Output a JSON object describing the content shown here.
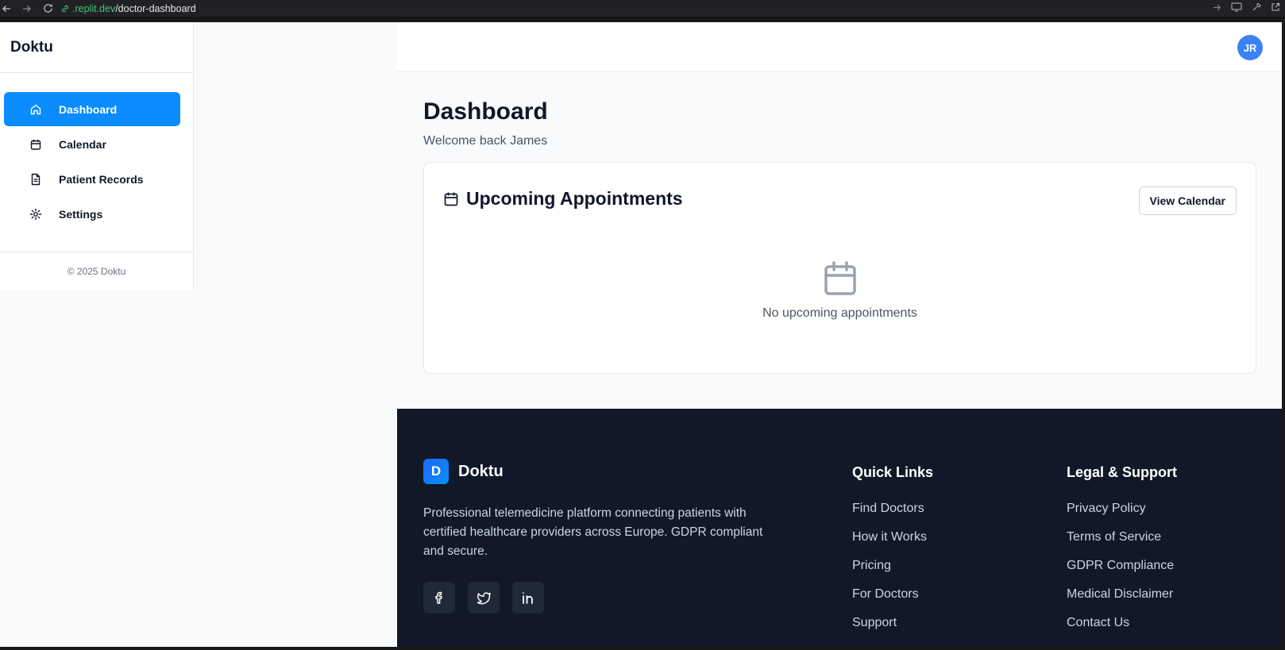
{
  "browser": {
    "url_domain": ".replit.dev",
    "url_path": "/doctor-dashboard"
  },
  "sidebar": {
    "brand": "Doktu",
    "items": [
      {
        "label": "Dashboard",
        "icon": "home-icon",
        "active": true
      },
      {
        "label": "Calendar",
        "icon": "calendar-icon",
        "active": false
      },
      {
        "label": "Patient Records",
        "icon": "file-text-icon",
        "active": false
      },
      {
        "label": "Settings",
        "icon": "gear-icon",
        "active": false
      }
    ],
    "footer": "© 2025 Doktu"
  },
  "header": {
    "avatar_initials": "JR"
  },
  "main": {
    "title": "Dashboard",
    "subtitle": "Welcome back James",
    "appointments": {
      "title": "Upcoming Appointments",
      "button": "View Calendar",
      "empty_text": "No upcoming appointments"
    }
  },
  "footer": {
    "logo_letter": "D",
    "brand": "Doktu",
    "description": "Professional telemedicine platform connecting patients with certified healthcare providers across Europe. GDPR compliant and secure.",
    "socials": [
      "facebook-icon",
      "twitter-icon",
      "linkedin-icon"
    ],
    "quick_links": {
      "title": "Quick Links",
      "links": [
        "Find Doctors",
        "How it Works",
        "Pricing",
        "For Doctors",
        "Support"
      ]
    },
    "legal": {
      "title": "Legal & Support",
      "links": [
        "Privacy Policy",
        "Terms of Service",
        "GDPR Compliance",
        "Medical Disclaimer",
        "Contact Us"
      ]
    }
  },
  "colors": {
    "accent": "#0a8cff",
    "avatar": "#3b82f6",
    "footer_bg": "#111827"
  }
}
